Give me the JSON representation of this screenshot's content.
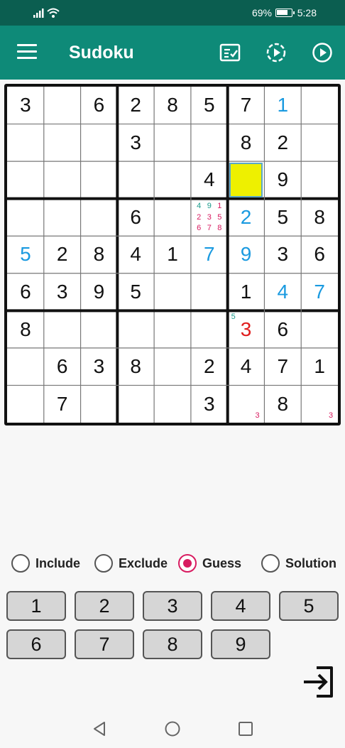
{
  "status_bar": {
    "battery_percent": "69%",
    "time": "5:28"
  },
  "app_bar": {
    "title": "Sudoku",
    "menu_icon": "hamburger-menu-icon",
    "actions": [
      "check-board-icon",
      "timer-play-icon",
      "play-icon"
    ]
  },
  "board": {
    "selected_cell": [
      2,
      6
    ],
    "cells": [
      [
        "3",
        "",
        "6",
        "2",
        "8",
        "5",
        "7",
        "1",
        ""
      ],
      [
        "",
        "",
        "",
        "3",
        "",
        "",
        "8",
        "2",
        ""
      ],
      [
        "",
        "",
        "",
        "",
        "",
        "4",
        "",
        "9",
        ""
      ],
      [
        "",
        "",
        "",
        "6",
        "",
        "",
        "2",
        "5",
        "8"
      ],
      [
        "5",
        "2",
        "8",
        "4",
        "1",
        "7",
        "9",
        "3",
        "6"
      ],
      [
        "6",
        "3",
        "9",
        "5",
        "",
        "",
        "1",
        "4",
        "7"
      ],
      [
        "8",
        "",
        "",
        "",
        "",
        "",
        "3",
        "6",
        ""
      ],
      [
        "",
        "6",
        "3",
        "8",
        "",
        "2",
        "4",
        "7",
        "1"
      ],
      [
        "",
        "7",
        "",
        "",
        "",
        "3",
        "",
        "8",
        ""
      ]
    ],
    "styles": [
      [
        "g",
        "",
        "g",
        "g",
        "g",
        "g",
        "g",
        "b",
        ""
      ],
      [
        "",
        "",
        "",
        "g",
        "",
        "",
        "g",
        "g",
        ""
      ],
      [
        "",
        "",
        "",
        "",
        "",
        "g",
        "",
        "g",
        ""
      ],
      [
        "",
        "",
        "",
        "g",
        "",
        "",
        "b",
        "g",
        "g"
      ],
      [
        "b",
        "g",
        "g",
        "g",
        "g",
        "b",
        "b",
        "g",
        "g"
      ],
      [
        "g",
        "g",
        "g",
        "g",
        "",
        "",
        "g",
        "b",
        "b"
      ],
      [
        "g",
        "",
        "",
        "",
        "",
        "",
        "r",
        "g",
        ""
      ],
      [
        "",
        "g",
        "g",
        "g",
        "",
        "g",
        "g",
        "g",
        "g"
      ],
      [
        "",
        "g",
        "",
        "",
        "",
        "g",
        "",
        "g",
        ""
      ]
    ],
    "notes": [
      {
        "row": 3,
        "col": 5,
        "values": [
          {
            "v": "4",
            "c": "#1a9a8a"
          },
          {
            "v": "9",
            "c": "#1a9a8a"
          },
          {
            "v": "1",
            "c": "#d81b60"
          },
          {
            "v": "2",
            "c": "#d81b60"
          },
          {
            "v": "3",
            "c": "#d81b60"
          },
          {
            "v": "5",
            "c": "#d81b60"
          },
          {
            "v": "6",
            "c": "#d81b60"
          },
          {
            "v": "7",
            "c": "#d81b60"
          },
          {
            "v": "8",
            "c": "#d81b60"
          }
        ]
      }
    ],
    "corner_notes": [
      {
        "row": 6,
        "col": 6,
        "pos": "top-left",
        "value": "5",
        "color": "#1a9a8a"
      },
      {
        "row": 8,
        "col": 6,
        "pos": "bottom-right",
        "value": "3",
        "color": "#d81b60"
      },
      {
        "row": 8,
        "col": 8,
        "pos": "bottom-right",
        "value": "3",
        "color": "#d81b60"
      }
    ]
  },
  "modes": {
    "selected": "Guess",
    "options": [
      "Include",
      "Exclude",
      "Guess",
      "Solution"
    ]
  },
  "numpad": {
    "keys": [
      "1",
      "2",
      "3",
      "4",
      "5",
      "6",
      "7",
      "8",
      "9"
    ]
  },
  "exit_button": "exit-icon",
  "nav_bar": [
    "back-icon",
    "home-icon",
    "recents-icon"
  ],
  "colors": {
    "status_bar": "#0b5e50",
    "app_bar": "#0e8a78",
    "blue_digit": "#1a9ae0",
    "red_digit": "#e01d1d",
    "selected_cell": "#eef000",
    "radio_accent": "#d81b60"
  }
}
